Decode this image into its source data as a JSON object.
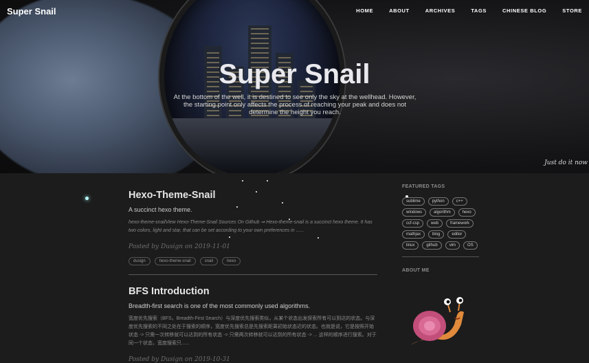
{
  "site": {
    "brand": "Super Snail",
    "nav": [
      "HOME",
      "ABOUT",
      "ARCHIVES",
      "TAGS",
      "CHINESE BLOG",
      "STORE"
    ]
  },
  "hero": {
    "title": "Super Snail",
    "subtitle": "At the bottom of the well, it is destined to see only the sky at the wellhead. However, the starting point only affects the process of reaching your peak and does not determine the height you reach.",
    "signature": "Just do it now"
  },
  "posts": [
    {
      "title": "Hexo-Theme-Snail",
      "subtitle": "A succinct hexo theme.",
      "excerpt": "hexo-theme-snailView Hexo-Theme-Snail Sources On Github ⇒ Hexo-theme-snail is a succinct hexo theme. It has two colors, light and star, that can be set according to your own preferences in ......",
      "meta": "Posted by Dusign on 2019-11-01",
      "tags": [
        "dusign",
        "hexo-theme-snail",
        "snail",
        "hexo"
      ]
    },
    {
      "title": "BFS Introduction",
      "subtitle": "Breadth-first search is one of the most commonly used algorithms.",
      "excerpt": "宽度优先搜索（BFS，Breadth-First Search）与深度优先搜索类似，从某个状态出发探索所有可以到达的状态。与深度优先搜索的不同之处在于搜索的顺序，宽度优先搜索总是先搜索距离初始状态近的状态。也就是说，它是按照开始状态 -> 只需一次转移就可以达到的所有状态 -> 只需两次转移就可以达到的所有状态 -> ... 这样的顺序进行搜索。对于同一个状态，宽度搜索只......",
      "meta": "Posted by Dusign on 2019-10-31"
    }
  ],
  "sidebar": {
    "featured_tags_heading": "FEATURED TAGS",
    "featured_tags": [
      "sublime",
      "python",
      "c++",
      "windows",
      "algorithm",
      "hexo",
      "ccf-csp",
      "web",
      "framework",
      "mathjax",
      "blog",
      "editor",
      "linux",
      "github",
      "vim",
      "OS"
    ],
    "about_heading": "ABOUT ME"
  }
}
